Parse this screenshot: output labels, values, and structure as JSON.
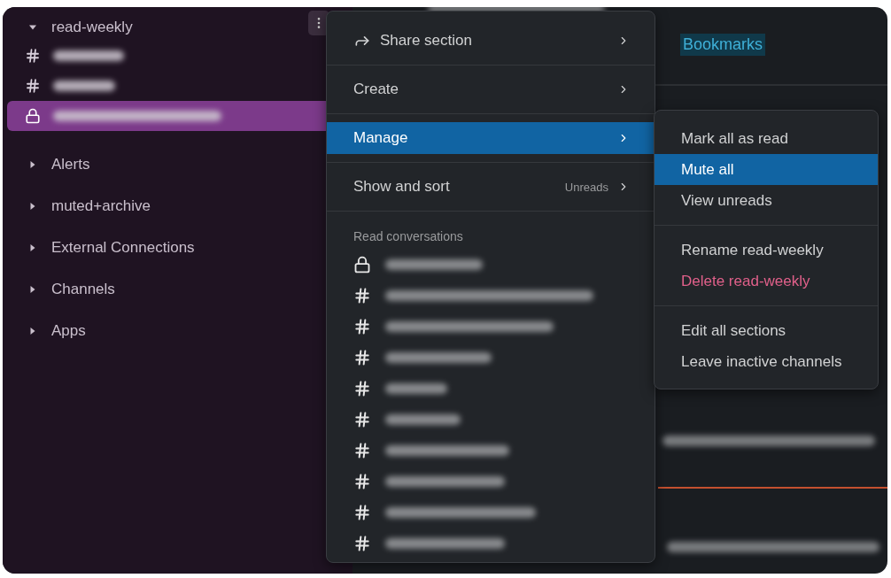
{
  "sidebar": {
    "sections": [
      {
        "label": "read-weekly",
        "expanded": true,
        "channels": [
          {
            "kind": "hash",
            "selected": false
          },
          {
            "kind": "hash",
            "selected": false
          },
          {
            "kind": "lock",
            "selected": true
          }
        ]
      },
      {
        "label": "Alerts",
        "expanded": false
      },
      {
        "label": "muted+archive",
        "expanded": false
      },
      {
        "label": "External Connections",
        "expanded": false
      },
      {
        "label": "Channels",
        "expanded": false
      },
      {
        "label": "Apps",
        "expanded": false
      }
    ]
  },
  "main": {
    "bookmarks_link": "Bookmarks"
  },
  "section_menu": {
    "items": [
      {
        "label": "Share section",
        "kind": "share",
        "selected": false
      },
      {
        "label": "Create",
        "kind": "plain",
        "selected": false
      },
      {
        "label": "Manage",
        "kind": "plain",
        "selected": true
      },
      {
        "label": "Show and sort",
        "kind": "plain",
        "hint": "Unreads",
        "selected": false
      }
    ],
    "read_conversations": {
      "heading": "Read conversations",
      "channels": [
        {
          "kind": "lock"
        },
        {
          "kind": "hash"
        },
        {
          "kind": "hash"
        },
        {
          "kind": "hash"
        },
        {
          "kind": "hash"
        },
        {
          "kind": "hash"
        },
        {
          "kind": "hash"
        },
        {
          "kind": "hash"
        },
        {
          "kind": "hash"
        },
        {
          "kind": "hash"
        }
      ]
    }
  },
  "manage_submenu": {
    "groups": [
      {
        "items": [
          {
            "label": "Mark all as read",
            "kind": "normal",
            "selected": false
          },
          {
            "label": "Mute all",
            "kind": "normal",
            "selected": true
          },
          {
            "label": "View unreads",
            "kind": "normal",
            "selected": false
          }
        ]
      },
      {
        "items": [
          {
            "label": "Rename read-weekly",
            "kind": "normal",
            "selected": false
          },
          {
            "label": "Delete read-weekly",
            "kind": "danger",
            "selected": false
          }
        ]
      },
      {
        "items": [
          {
            "label": "Edit all sections",
            "kind": "normal",
            "selected": false
          },
          {
            "label": "Leave inactive channels",
            "kind": "normal",
            "selected": false
          }
        ]
      }
    ]
  }
}
